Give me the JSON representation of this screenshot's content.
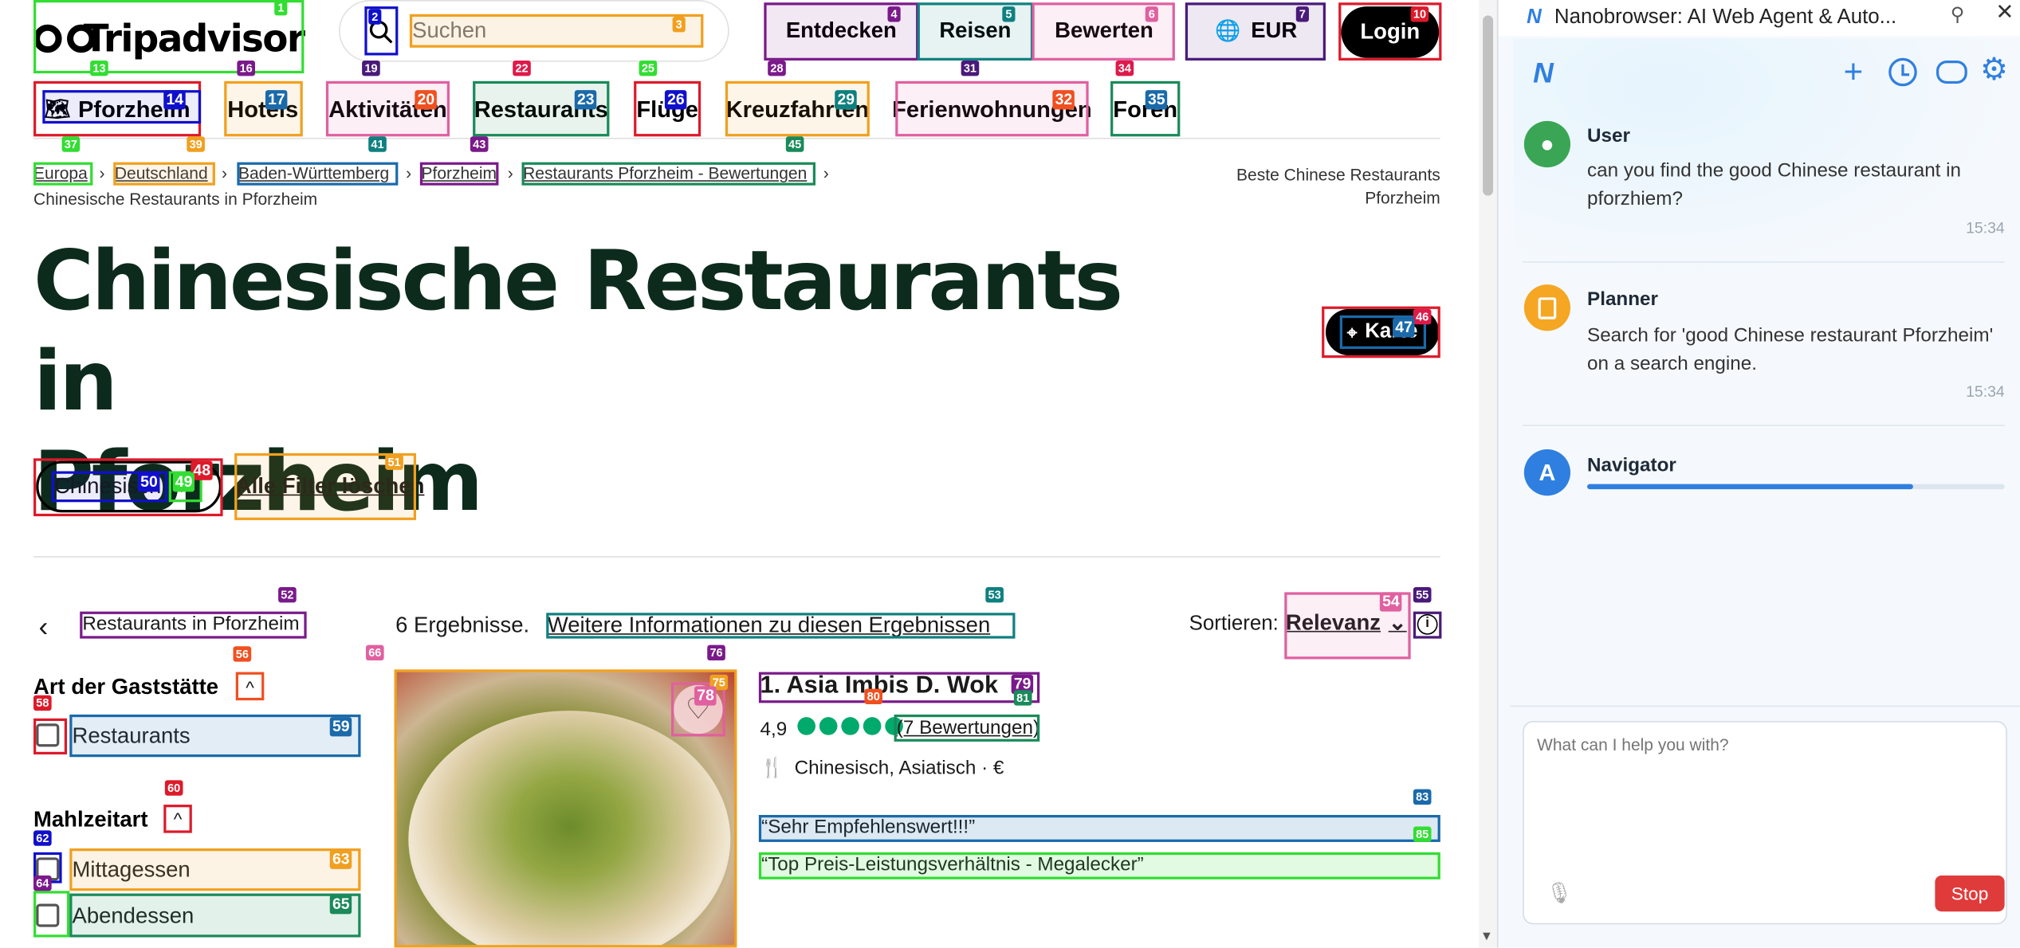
{
  "header": {
    "logo_text": "Tripadvisor",
    "search_placeholder": "Suchen",
    "nav": [
      "Entdecken",
      "Reisen",
      "Bewerten"
    ],
    "currency": "EUR",
    "login": "Login"
  },
  "chips": [
    "Pforzheim",
    "Hotels",
    "Aktivitäten",
    "Restaurants",
    "Flüge",
    "Kreuzfahrten",
    "Ferienwohnungen",
    "Foren"
  ],
  "breadcrumbs": [
    "Europa",
    "Deutschland",
    "Baden-Württemberg",
    "Pforzheim",
    "Restaurants Pforzheim - Bewertungen",
    "Chinesische Restaurants in Pforzheim"
  ],
  "right_note": [
    "Beste Chinese Restaurants",
    "Pforzheim"
  ],
  "page_title": [
    "Chinesische Restaurants in",
    "Pforzheim"
  ],
  "map_button": "Karte",
  "filter_chip": "Chinesisch",
  "clear_filters": "Alle Filter löschen",
  "results": {
    "back_label": "Restaurants in Pforzheim",
    "count_text": "6 Ergebnisse.",
    "info_link": "Weitere Informationen zu diesen Ergebnissen",
    "sort_label": "Sortieren:",
    "sort_value": "Relevanz"
  },
  "sidebar": {
    "type_heading": "Art der Gaststätte",
    "type_options": [
      "Restaurants"
    ],
    "meal_heading": "Mahlzeitart",
    "meal_options": [
      "Mittagessen",
      "Abendessen"
    ]
  },
  "card": {
    "name": "1. Asia Imbis D. Wok",
    "rating": "4,9",
    "reviews": "(7 Bewertungen)",
    "cuisine": "Chinesisch, Asiatisch · €",
    "quote1": "“Sehr Empfehlenswert!!!”",
    "quote2": "“Top Preis-Leistungsverhältnis - Megalecker”"
  },
  "panel": {
    "title": "Nanobrowser: AI Web Agent & Auto...",
    "messages": [
      {
        "name": "User",
        "text": "can you find the good Chinese restaurant in pforzhiem?",
        "time": "15:34"
      },
      {
        "name": "Planner",
        "text": "Search for 'good Chinese restaurant Pforzheim' on a search engine.",
        "time": "15:34"
      },
      {
        "name": "Navigator",
        "progress": 0.78
      }
    ],
    "input_placeholder": "What can I help you with?",
    "stop_label": "Stop"
  },
  "colors": {
    "brand_green": "#00aa6c",
    "title_green": "#0d2b1c",
    "nano_blue": "#2f7fe0",
    "stop_red": "#e03b3b"
  },
  "annotation_labels": [
    "1",
    "2",
    "3",
    "4",
    "5",
    "6",
    "7",
    "10",
    "13",
    "14",
    "16",
    "17",
    "19",
    "20",
    "22",
    "23",
    "25",
    "26",
    "28",
    "29",
    "31",
    "32",
    "34",
    "35",
    "37",
    "39",
    "41",
    "43",
    "45",
    "46",
    "47",
    "48",
    "49",
    "50",
    "51",
    "52",
    "53",
    "54",
    "55",
    "56",
    "58",
    "59",
    "60",
    "62",
    "63",
    "64",
    "65",
    "66",
    "75",
    "76",
    "78",
    "79",
    "80",
    "81",
    "83",
    "85"
  ]
}
